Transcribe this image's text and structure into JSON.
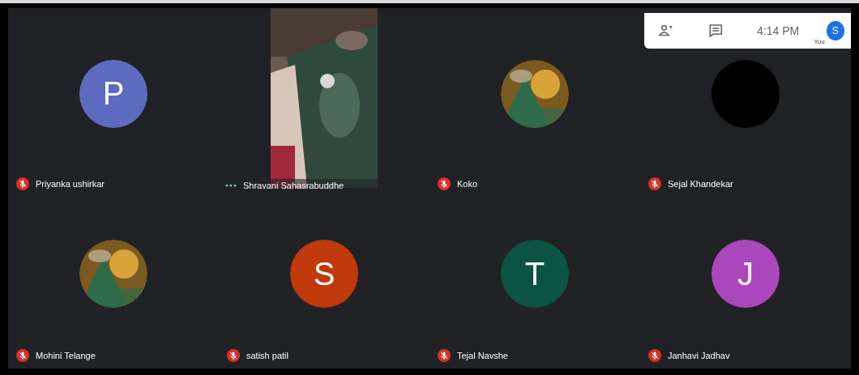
{
  "tiles": [
    {
      "name": "Priyanka ushirkar",
      "kind": "letter",
      "letter": "P",
      "color": "#5c6bc0",
      "muted": true
    },
    {
      "name": "Shravani Sahasrabuddhe",
      "kind": "video",
      "muted": false
    },
    {
      "name": "Koko",
      "muted": true
    },
    {
      "name": "Sejal Khandekar",
      "kind": "blank",
      "muted": true
    },
    {
      "name": "Mohini Telange",
      "muted": true
    },
    {
      "name": "satish patil",
      "kind": "letter",
      "letter": "S",
      "color": "#c0390b",
      "muted": true
    },
    {
      "name": "Tejal Navshe",
      "kind": "letter",
      "letter": "T",
      "color": "#0b5345",
      "muted": true
    },
    {
      "name": "Janhavi Jadhav",
      "kind": "letter",
      "letter": "J",
      "color": "#ab47bc",
      "muted": true
    }
  ],
  "top_bar": {
    "time": "4:14 PM",
    "self_label": "You",
    "self_letter": "S"
  }
}
